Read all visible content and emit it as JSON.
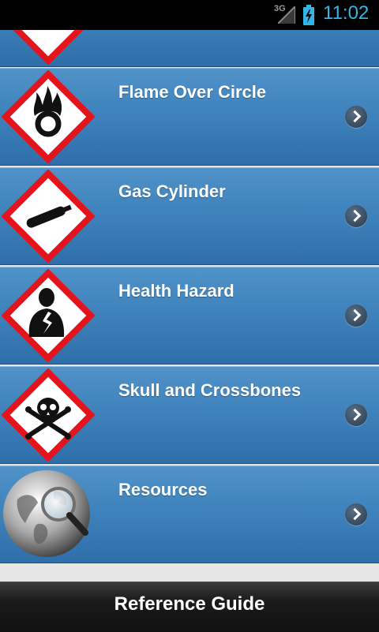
{
  "status_bar": {
    "network": "3G",
    "time": "11:02"
  },
  "list": {
    "items": [
      {
        "label": "",
        "icon": "pictogram-partial-icon"
      },
      {
        "label": "Flame Over Circle",
        "icon": "flame-over-circle-icon"
      },
      {
        "label": "Gas Cylinder",
        "icon": "gas-cylinder-icon"
      },
      {
        "label": "Health Hazard",
        "icon": "health-hazard-icon"
      },
      {
        "label": "Skull and Crossbones",
        "icon": "skull-crossbones-icon"
      },
      {
        "label": "Resources",
        "icon": "globe-magnifier-icon"
      }
    ]
  },
  "footer": {
    "title": "Reference Guide"
  },
  "colors": {
    "row_blue": "#3c7fb9",
    "diamond_red": "#e3141c",
    "clock_blue": "#33b5e5"
  }
}
